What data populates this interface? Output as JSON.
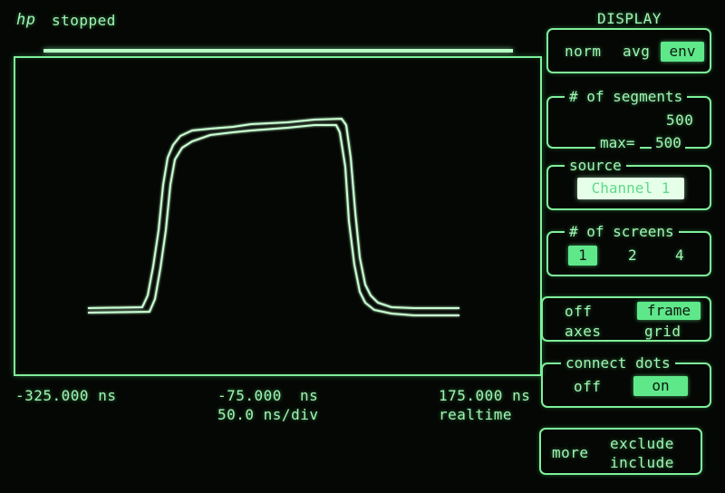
{
  "header": {
    "logo": "hp",
    "status": "stopped",
    "panel_title": "DISPLAY"
  },
  "plot": {
    "left_time": "-325.000 ns",
    "center_time": "-75.000",
    "center_unit": "ns",
    "timebase": "50.0 ns/div",
    "right_time": "175.000 ns",
    "mode": "realtime"
  },
  "softkeys": {
    "display_mode": {
      "options": [
        "norm",
        "avg",
        "env"
      ],
      "selected": "env"
    },
    "segments": {
      "label": "# of segments",
      "value": "500",
      "max_label": "max=",
      "max_value": "500"
    },
    "source": {
      "label": "source",
      "value": "Channel 1"
    },
    "screens": {
      "label": "# of screens",
      "options": [
        "1",
        "2",
        "4"
      ],
      "selected": "1"
    },
    "axes_grid": {
      "off": "off",
      "frame": "frame",
      "axes": "axes",
      "grid": "grid",
      "selected": "frame"
    },
    "connect_dots": {
      "label": "connect dots",
      "off": "off",
      "on": "on",
      "selected": "on"
    },
    "exclude": {
      "more": "more",
      "exclude": "exclude",
      "include": "include"
    }
  },
  "colors": {
    "phosphor": "#7ff09a",
    "trace": "#c9ffd2",
    "highlight": "#5fe88a",
    "background": "#050704"
  }
}
